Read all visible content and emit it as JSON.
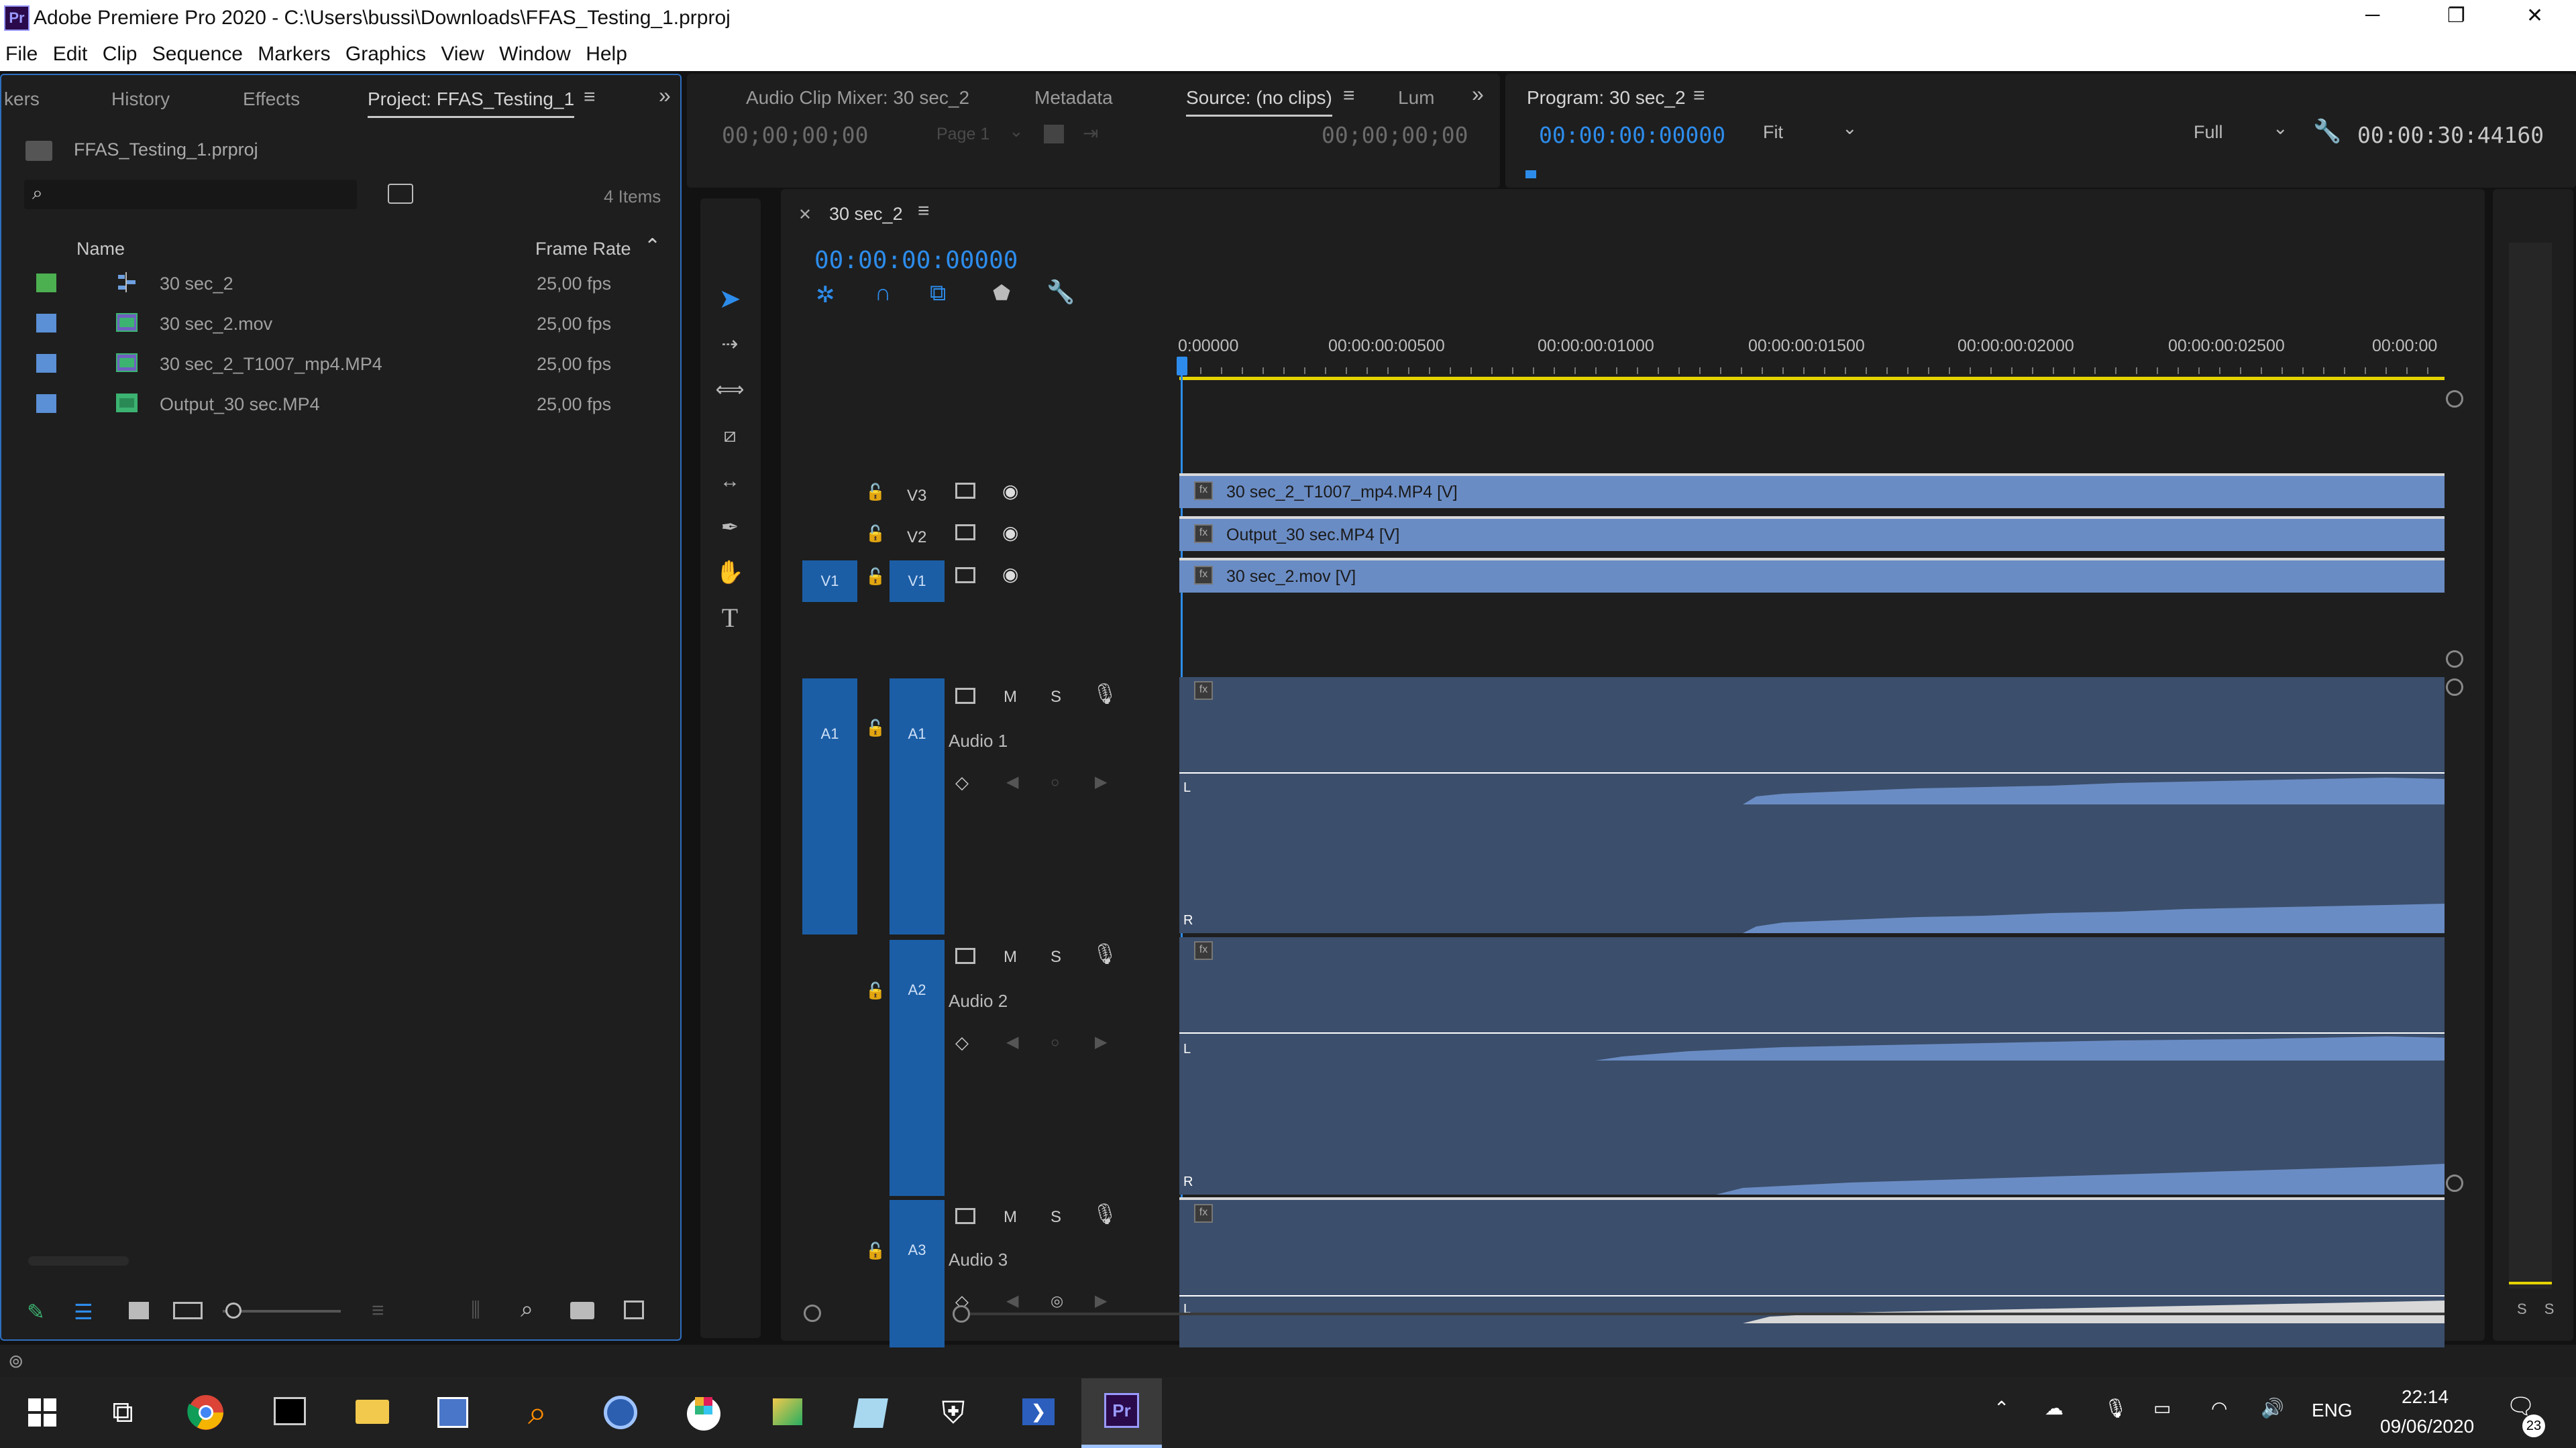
{
  "window": {
    "title": "Adobe Premiere Pro 2020 - C:\\Users\\bussi\\Downloads\\FFAS_Testing_1.prproj",
    "app_icon": "Pr",
    "controls": {
      "minimize": "─",
      "maximize": "❐",
      "close": "✕"
    }
  },
  "menu": [
    "File",
    "Edit",
    "Clip",
    "Sequence",
    "Markers",
    "Graphics",
    "View",
    "Window",
    "Help"
  ],
  "project_panel": {
    "tabs": [
      "kers",
      "History",
      "Effects",
      "Project: FFAS_Testing_1"
    ],
    "file": "FFAS_Testing_1.prproj",
    "items_count": "4 Items",
    "columns": {
      "name": "Name",
      "frame_rate": "Frame Rate"
    },
    "rows": [
      {
        "name": "30 sec_2",
        "fps": "25,00 fps",
        "color": "#4caf50",
        "icon": "sequence-icon"
      },
      {
        "name": "30 sec_2.mov",
        "fps": "25,00 fps",
        "color": "#5b8fd6",
        "icon": "video-file-icon"
      },
      {
        "name": "30 sec_2_T1007_mp4.MP4",
        "fps": "25,00 fps",
        "color": "#5b8fd6",
        "icon": "video-file-icon"
      },
      {
        "name": "Output_30 sec.MP4",
        "fps": "25,00 fps",
        "color": "#5b8fd6",
        "icon": "video-file-icon"
      }
    ]
  },
  "source_panel": {
    "tabs": [
      "Audio Clip Mixer: 30 sec_2",
      "Metadata",
      "Source: (no clips)",
      "Lum"
    ],
    "timecode_left": "00;00;00;00",
    "page": "Page 1",
    "timecode_right": "00;00;00;00"
  },
  "program_panel": {
    "title": "Program: 30 sec_2",
    "timecode": "00:00:00:00000",
    "fit": "Fit",
    "quality": "Full",
    "duration": "00:00:30:44160"
  },
  "timeline": {
    "tab": "30 sec_2",
    "timecode": "00:00:00:00000",
    "ruler": [
      "0:00000",
      "00:00:00:00500",
      "00:00:00:01000",
      "00:00:00:01500",
      "00:00:00:02000",
      "00:00:00:02500",
      "00:00:00"
    ],
    "video_tracks": [
      {
        "name": "V3",
        "clip": "30 sec_2_T1007_mp4.MP4 [V]"
      },
      {
        "name": "V2",
        "clip": "Output_30 sec.MP4 [V]"
      },
      {
        "name": "V1",
        "clip": "30 sec_2.mov [V]"
      }
    ],
    "source_patch": {
      "video": "V1",
      "audio": "A1"
    },
    "audio_tracks": [
      {
        "name": "A1",
        "label": "Audio 1"
      },
      {
        "name": "A2",
        "label": "Audio 2"
      },
      {
        "name": "A3",
        "label": "Audio 3"
      }
    ],
    "mute": "M",
    "solo": "S",
    "channel_left": "L",
    "channel_right": "R",
    "fx": "fx"
  },
  "meters": {
    "labels": "S S"
  },
  "taskbar": {
    "language": "ENG",
    "time": "22:14",
    "date": "09/06/2020",
    "notifications": "23"
  }
}
